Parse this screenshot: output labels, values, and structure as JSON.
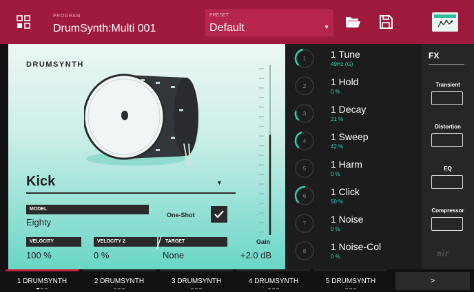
{
  "header": {
    "program_label": "PROGRAM",
    "program_name": "DrumSynth:Multi 001",
    "preset_label": "PRESET",
    "preset_name": "Default"
  },
  "main": {
    "logo": "DRUMSYNTH",
    "drum_type": "Kick",
    "model": {
      "label": "MODEL",
      "value": "Eighty"
    },
    "one_shot": {
      "label": "One-Shot",
      "checked": true
    },
    "velocity": {
      "label": "VELOCITY",
      "value": "100 %"
    },
    "velocity2": {
      "label": "VELOCITY 2",
      "value": "0 %"
    },
    "target": {
      "label": "TARGET",
      "value": "None"
    },
    "gain": {
      "label": "Gain",
      "value": "+2.0 dB"
    }
  },
  "params": [
    {
      "num": "1",
      "name": "1 Tune",
      "value": "49Hz (G)",
      "level": 0.45
    },
    {
      "num": "2",
      "name": "1 Hold",
      "value": "0 %",
      "level": 0
    },
    {
      "num": "3",
      "name": "1 Decay",
      "value": "21 %",
      "level": 0.21
    },
    {
      "num": "4",
      "name": "1 Sweep",
      "value": "42 %",
      "level": 0.42
    },
    {
      "num": "5",
      "name": "1 Harm",
      "value": "0 %",
      "level": 0
    },
    {
      "num": "6",
      "name": "1 Click",
      "value": "50 %",
      "level": 0.5
    },
    {
      "num": "7",
      "name": "1 Noise",
      "value": "0 %",
      "level": 0
    },
    {
      "num": "8",
      "name": "1 Noise-Col",
      "value": "0 %",
      "level": 0
    }
  ],
  "fx": {
    "title": "FX",
    "slots": [
      "Transient",
      "Distortion",
      "EQ",
      "Compressor"
    ],
    "brand": "air"
  },
  "tabs": [
    {
      "label": "1 DRUMSYNTH",
      "active": true
    },
    {
      "label": "2 DRUMSYNTH",
      "active": false
    },
    {
      "label": "3 DRUMSYNTH",
      "active": false
    },
    {
      "label": "4 DRUMSYNTH",
      "active": false
    },
    {
      "label": "5 DRUMSYNTH",
      "active": false
    }
  ],
  "next_label": ">",
  "colors": {
    "brand": "#9e1a3c",
    "accent": "#2fd3b5",
    "active_tab": "#c41e3a"
  }
}
